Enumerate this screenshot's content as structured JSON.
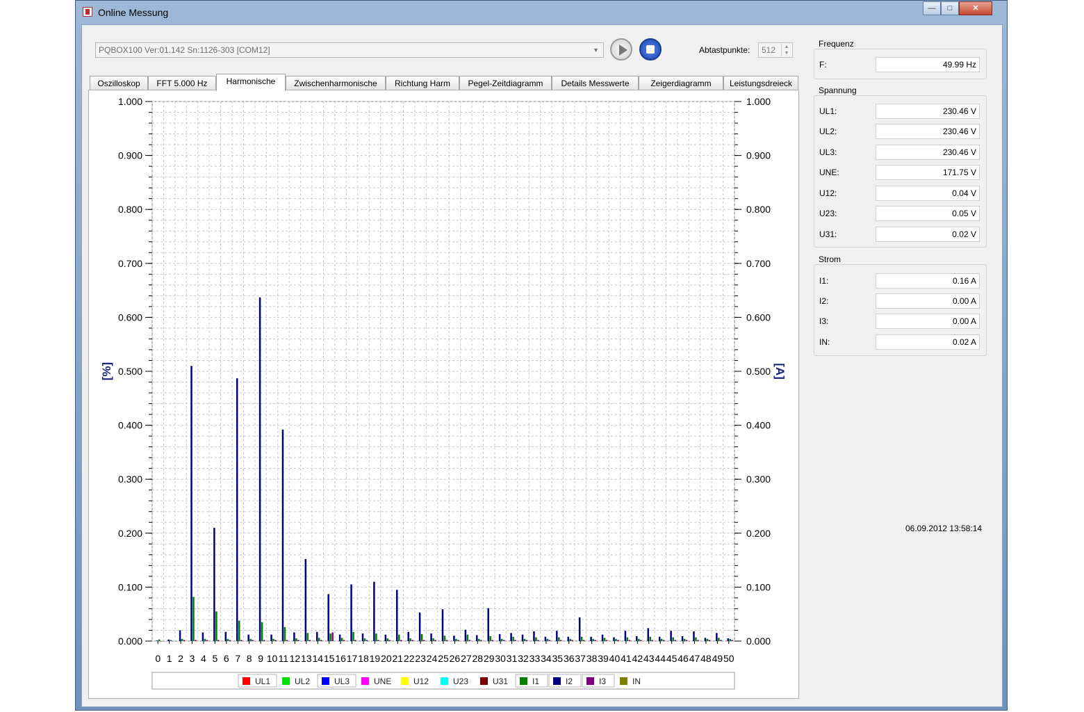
{
  "window": {
    "title": "Online Messung"
  },
  "toolbar": {
    "device": "PQBOX100 Ver:01.142 Sn:1126-303 [COM12]",
    "sample_points_label": "Abtastpunkte:",
    "sample_points_value": "512"
  },
  "tabs": [
    {
      "label": "Oszilloskop"
    },
    {
      "label": "FFT 5.000 Hz"
    },
    {
      "label": "Harmonische",
      "active": true
    },
    {
      "label": "Zwischenharmonische"
    },
    {
      "label": "Richtung Harm"
    },
    {
      "label": "Pegel-Zeitdiagramm"
    },
    {
      "label": "Details Messwerte"
    },
    {
      "label": "Zeigerdiagramm"
    },
    {
      "label": "Leistungsdreieck"
    }
  ],
  "panels": {
    "frequency": {
      "title": "Frequenz",
      "rows": [
        {
          "label": "F:",
          "value": "49.99 Hz"
        }
      ]
    },
    "voltage": {
      "title": "Spannung",
      "rows": [
        {
          "label": "UL1:",
          "value": "230.46 V"
        },
        {
          "label": "UL2:",
          "value": "230.46 V"
        },
        {
          "label": "UL3:",
          "value": "230.46 V"
        },
        {
          "label": "UNE:",
          "value": "171.75 V"
        },
        {
          "label": "U12:",
          "value": "0.04 V"
        },
        {
          "label": "U23:",
          "value": "0.05 V"
        },
        {
          "label": "U31:",
          "value": "0.02 V"
        }
      ]
    },
    "current": {
      "title": "Strom",
      "rows": [
        {
          "label": "I1:",
          "value": "0.16 A"
        },
        {
          "label": "I2:",
          "value": "0.00 A"
        },
        {
          "label": "I3:",
          "value": "0.00 A"
        },
        {
          "label": "IN:",
          "value": "0.02 A"
        }
      ]
    }
  },
  "timestamp": "06.09.2012 13:58:14",
  "chart_data": {
    "type": "bar",
    "ylabel": "[%]",
    "y2label": "[A]",
    "ylim": [
      0,
      1
    ],
    "y2lim": [
      0,
      1
    ],
    "yticks": [
      "0.000",
      "0.100",
      "0.200",
      "0.300",
      "0.400",
      "0.500",
      "0.600",
      "0.700",
      "0.800",
      "0.900",
      "1.000"
    ],
    "grid": true,
    "legend_position": "bottom",
    "categories": [
      "0",
      "1",
      "2",
      "3",
      "4",
      "5",
      "6",
      "7",
      "8",
      "9",
      "10",
      "11",
      "12",
      "13",
      "14",
      "15",
      "16",
      "17",
      "18",
      "19",
      "20",
      "21",
      "22",
      "23",
      "24",
      "25",
      "26",
      "27",
      "28",
      "29",
      "30",
      "31",
      "32",
      "33",
      "34",
      "35",
      "36",
      "37",
      "38",
      "39",
      "40",
      "41",
      "42",
      "43",
      "44",
      "45",
      "46",
      "47",
      "48",
      "49",
      "50"
    ],
    "legend": [
      {
        "name": "UL1",
        "color": "#ff0000"
      },
      {
        "name": "UL2",
        "color": "#00e000"
      },
      {
        "name": "UL3",
        "color": "#0000ff"
      },
      {
        "name": "UNE",
        "color": "#ff00ff"
      },
      {
        "name": "U12",
        "color": "#ffff00"
      },
      {
        "name": "U23",
        "color": "#00ffff"
      },
      {
        "name": "U31",
        "color": "#800000"
      },
      {
        "name": "I1",
        "color": "#008000"
      },
      {
        "name": "I2",
        "color": "#000080"
      },
      {
        "name": "I3",
        "color": "#800080"
      },
      {
        "name": "IN",
        "color": "#808000"
      }
    ],
    "series": [
      {
        "name": "I1",
        "color": "#008000",
        "values": [
          0.003,
          0.002,
          0.004,
          0.082,
          0.004,
          0.055,
          0.004,
          0.038,
          0.004,
          0.035,
          0.004,
          0.026,
          0.005,
          0.015,
          0.006,
          0.014,
          0.006,
          0.017,
          0.005,
          0.014,
          0.005,
          0.012,
          0.005,
          0.013,
          0.005,
          0.01,
          0.004,
          0.012,
          0.004,
          0.009,
          0.004,
          0.008,
          0.004,
          0.007,
          0.004,
          0.007,
          0.004,
          0.008,
          0.004,
          0.006,
          0.004,
          0.007,
          0.004,
          0.008,
          0.004,
          0.007,
          0.004,
          0.007,
          0.004,
          0.006,
          0.004
        ]
      },
      {
        "name": "I2",
        "color": "#000080",
        "values": [
          0.001,
          0.003,
          0.02,
          0.51,
          0.016,
          0.21,
          0.017,
          0.487,
          0.012,
          0.637,
          0.012,
          0.392,
          0.016,
          0.152,
          0.017,
          0.087,
          0.012,
          0.105,
          0.014,
          0.11,
          0.012,
          0.095,
          0.017,
          0.053,
          0.014,
          0.059,
          0.01,
          0.021,
          0.011,
          0.061,
          0.013,
          0.015,
          0.012,
          0.018,
          0.008,
          0.019,
          0.008,
          0.044,
          0.008,
          0.012,
          0.007,
          0.019,
          0.009,
          0.024,
          0.008,
          0.019,
          0.009,
          0.018,
          0.006,
          0.015,
          0.005
        ]
      },
      {
        "name": "I3",
        "color": "#800080",
        "values": [
          0.0,
          0.0,
          0.002,
          0.002,
          0.002,
          0.002,
          0.002,
          0.002,
          0.002,
          0.002,
          0.002,
          0.002,
          0.002,
          0.002,
          0.002,
          0.016,
          0.002,
          0.002,
          0.002,
          0.002,
          0.002,
          0.002,
          0.002,
          0.002,
          0.002,
          0.002,
          0.002,
          0.002,
          0.002,
          0.002,
          0.002,
          0.002,
          0.002,
          0.002,
          0.002,
          0.002,
          0.002,
          0.002,
          0.002,
          0.002,
          0.002,
          0.002,
          0.002,
          0.002,
          0.002,
          0.002,
          0.002,
          0.002,
          0.002,
          0.002,
          0.002
        ]
      }
    ]
  }
}
